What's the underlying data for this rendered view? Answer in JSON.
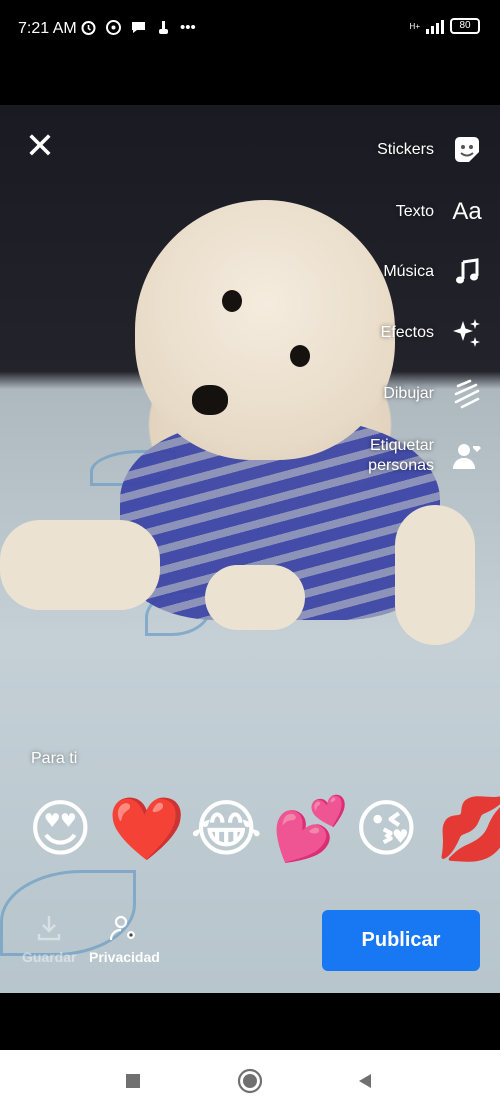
{
  "status": {
    "time": "7:21 AM",
    "battery": "80",
    "network": "H+"
  },
  "editor": {
    "close_label": "✕",
    "tools": [
      {
        "label": "Stickers",
        "icon": "sticker-icon"
      },
      {
        "label": "Texto",
        "icon": "text-aa-icon",
        "glyph": "Aa"
      },
      {
        "label": "Música",
        "icon": "music-note-icon"
      },
      {
        "label": "Efectos",
        "icon": "sparkles-icon"
      },
      {
        "label": "Dibujar",
        "icon": "draw-squiggle-icon"
      },
      {
        "label": "Etiquetar\npersonas",
        "icon": "tag-people-icon"
      }
    ],
    "section_label": "Para ti",
    "reactions": [
      "😍",
      "❤️",
      "😂",
      "💕",
      "😘",
      "💋"
    ],
    "save_label": "Guardar",
    "privacy_label": "Privacidad",
    "publish_label": "Publicar"
  },
  "colors": {
    "publish": "#1877f2",
    "background": "#000000"
  }
}
